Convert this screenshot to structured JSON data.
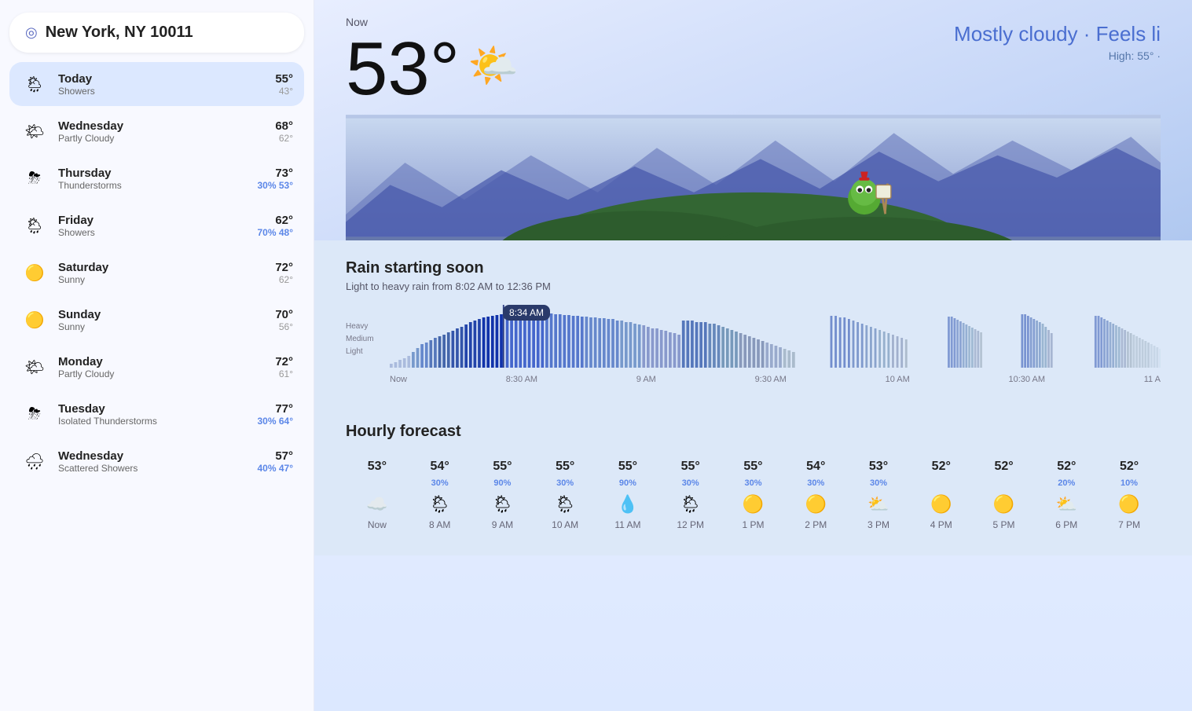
{
  "location": {
    "text": "New York, NY 10011",
    "pin_icon": "📍"
  },
  "days": [
    {
      "name": "Today",
      "condition": "Showers",
      "high": "55°",
      "low": "43°",
      "precip": "",
      "icon": "grid",
      "today": true
    },
    {
      "name": "Wednesday",
      "condition": "Partly Cloudy",
      "high": "68°",
      "low": "62°",
      "precip": "",
      "icon": "sun-partly",
      "today": false
    },
    {
      "name": "Thursday",
      "condition": "Thunderstorms",
      "high": "73°",
      "low": "53°",
      "precip": "30%",
      "icon": "thunder",
      "today": false
    },
    {
      "name": "Friday",
      "condition": "Showers",
      "high": "62°",
      "low": "48°",
      "precip": "70%",
      "icon": "grid",
      "today": false
    },
    {
      "name": "Saturday",
      "condition": "Sunny",
      "high": "72°",
      "low": "62°",
      "precip": "",
      "icon": "sun",
      "today": false
    },
    {
      "name": "Sunday",
      "condition": "Sunny",
      "high": "70°",
      "low": "56°",
      "precip": "",
      "icon": "sun",
      "today": false
    },
    {
      "name": "Monday",
      "condition": "Partly Cloudy",
      "high": "72°",
      "low": "61°",
      "precip": "",
      "icon": "sun-partly",
      "today": false
    },
    {
      "name": "Tuesday",
      "condition": "Isolated Thunderstorms",
      "high": "77°",
      "low": "64°",
      "precip": "30%",
      "icon": "thunder",
      "today": false
    },
    {
      "name": "Wednesday",
      "condition": "Scattered Showers",
      "high": "57°",
      "low": "47°",
      "precip": "40%",
      "icon": "rain",
      "today": false
    }
  ],
  "current": {
    "now_label": "Now",
    "temperature": "53°",
    "condition": "Mostly cloudy · Feels li",
    "detail": "High: 55° ·",
    "icon": "☁️"
  },
  "rain_forecast": {
    "title": "Rain starting soon",
    "subtitle": "Light to heavy rain from 8:02 AM to 12:36 PM",
    "tooltip_time": "8:34 AM",
    "legend": [
      "Heavy",
      "Medium",
      "Light"
    ],
    "x_axis": [
      "Now",
      "8:30 AM",
      "9 AM",
      "9:30 AM",
      "10 AM",
      "10:30 AM",
      "11 A"
    ]
  },
  "hourly": {
    "title": "Hourly forecast",
    "hours": [
      {
        "label": "Now",
        "temp": "53°",
        "precip": "",
        "icon": "cloud"
      },
      {
        "label": "8 AM",
        "temp": "54°",
        "precip": "30%",
        "icon": "showers"
      },
      {
        "label": "9 AM",
        "temp": "55°",
        "precip": "90%",
        "icon": "showers"
      },
      {
        "label": "10 AM",
        "temp": "55°",
        "precip": "30%",
        "icon": "showers"
      },
      {
        "label": "11 AM",
        "temp": "55°",
        "precip": "90%",
        "icon": "rain-drops"
      },
      {
        "label": "12 PM",
        "temp": "55°",
        "precip": "30%",
        "icon": "showers"
      },
      {
        "label": "1 PM",
        "temp": "55°",
        "precip": "30%",
        "icon": "sun"
      },
      {
        "label": "2 PM",
        "temp": "54°",
        "precip": "30%",
        "icon": "sun"
      },
      {
        "label": "3 PM",
        "temp": "53°",
        "precip": "30%",
        "icon": "sun-partly"
      },
      {
        "label": "4 PM",
        "temp": "52°",
        "precip": "",
        "icon": "sun"
      },
      {
        "label": "5 PM",
        "temp": "52°",
        "precip": "",
        "icon": "sun"
      },
      {
        "label": "6 PM",
        "temp": "52°",
        "precip": "20%",
        "icon": "sun-partly"
      },
      {
        "label": "7 PM",
        "temp": "52°",
        "precip": "10%",
        "icon": "sun"
      }
    ]
  }
}
